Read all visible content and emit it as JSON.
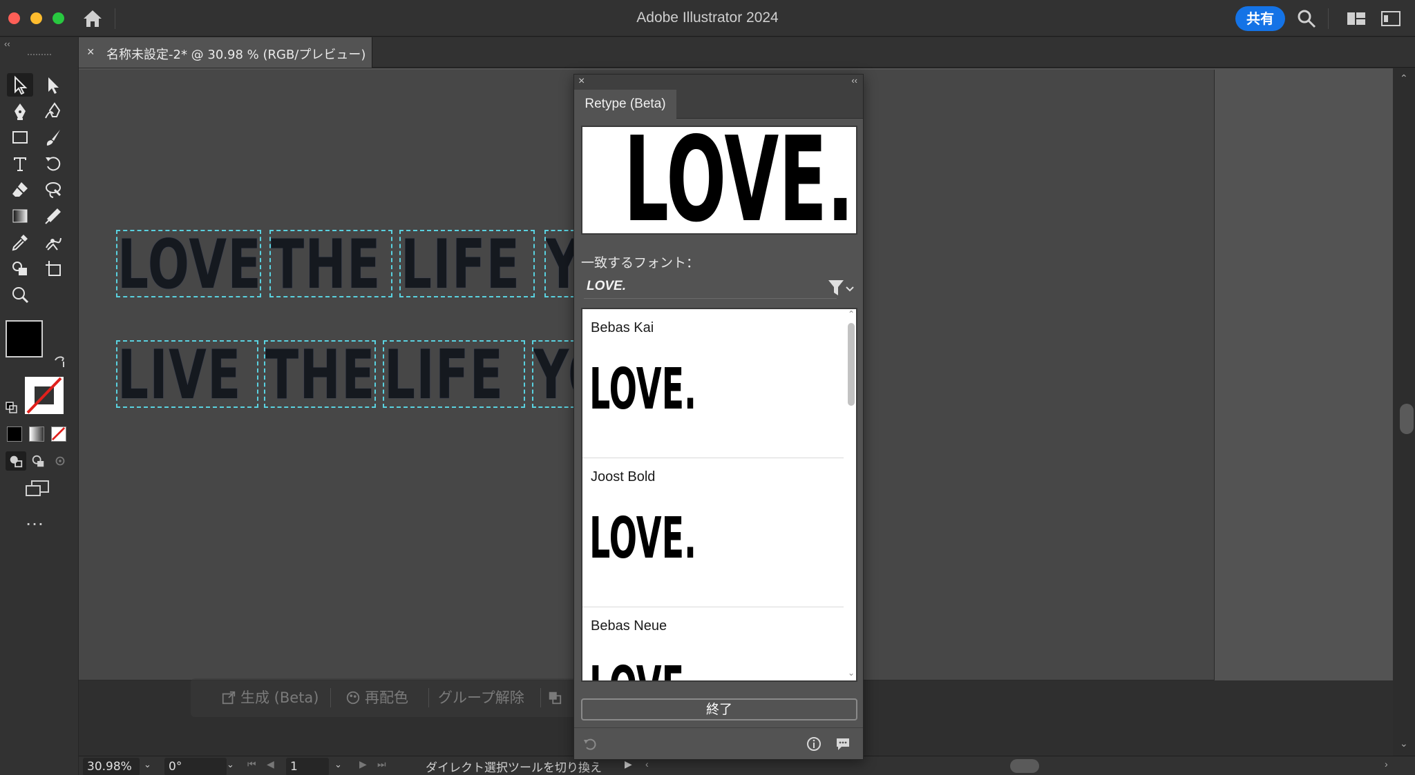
{
  "window": {
    "title": "Adobe Illustrator 2024",
    "share_label": "共有"
  },
  "document": {
    "tab_label": "名称未設定-2* @ 30.98 % (RGB/プレビュー)",
    "tab_close": "×"
  },
  "canvas": {
    "rows": [
      {
        "words": [
          "LOVE",
          "THE",
          "LIFE",
          "YO"
        ]
      },
      {
        "words": [
          "LIVE",
          "THE",
          "LIFE",
          "YO"
        ]
      }
    ]
  },
  "context_bar": {
    "generate_label": "生成 (Beta)",
    "recolor_label": "再配色",
    "ungroup_label": "グループ解除"
  },
  "status_bar": {
    "zoom": "30.98%",
    "rotation": "0°",
    "artboard_number": "1",
    "status_text": "ダイレクト選択ツールを切り換え"
  },
  "retype_panel": {
    "tab_label": "Retype (Beta)",
    "preview_text": "LOVE.",
    "match_label": "一致するフォント：",
    "query_text": "LOVE.",
    "fonts": [
      {
        "name": "Bebas Kai",
        "sample": "LOVE."
      },
      {
        "name": "Joost Bold",
        "sample": "LOVE."
      },
      {
        "name": "Bebas Neue",
        "sample": "LOVE."
      }
    ],
    "done_label": "終了"
  },
  "colors": {
    "accent_blue": "#1473e6",
    "selection_cyan": "#5ad2e0",
    "canvas_bg": "#535353",
    "artboard_bg": "#474747"
  },
  "icons": {
    "toolbar": [
      "selection-tool-icon",
      "direct-selection-tool-icon",
      "pen-tool-icon",
      "curvature-tool-icon",
      "rectangle-tool-icon",
      "paintbrush-tool-icon",
      "type-tool-icon",
      "rotate-tool-icon",
      "eraser-tool-icon",
      "lasso-tool-icon",
      "gradient-tool-icon",
      "eyedropper-tool-icon",
      "puppet-warp-icon",
      "shape-builder-icon",
      "artboard-tool-icon",
      "zoom-tool-icon"
    ]
  }
}
